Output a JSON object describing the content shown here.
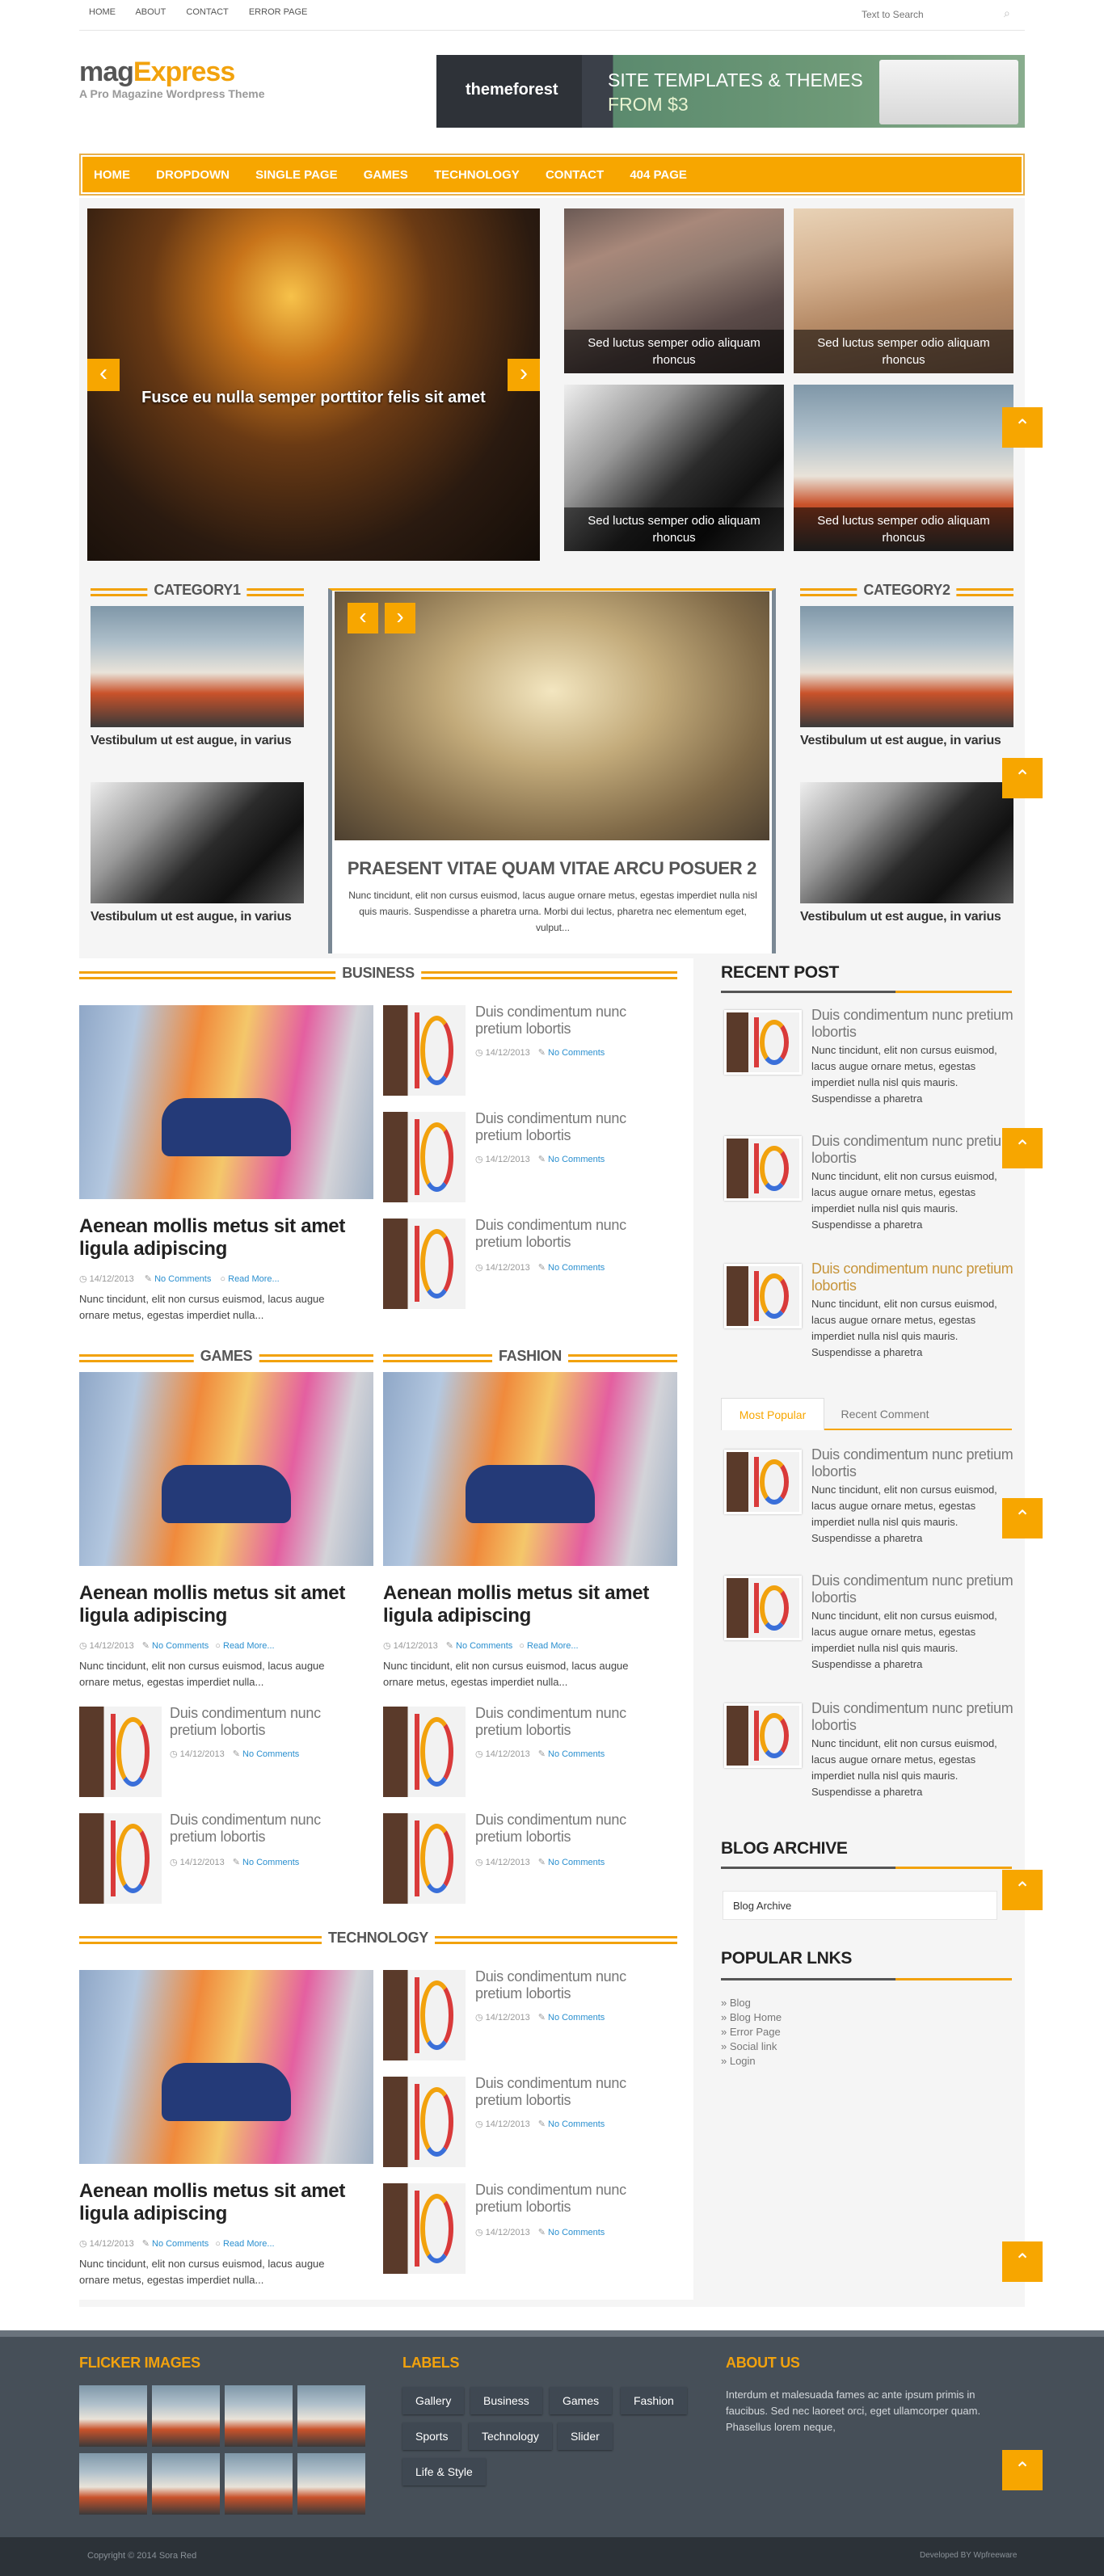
{
  "topnav": {
    "items": [
      "HOME",
      "ABOUT",
      "CONTACT",
      "ERROR PAGE"
    ],
    "search_placeholder": "Text to Search"
  },
  "brand": {
    "name_a": "mag",
    "name_b": "Express",
    "tagline": "A Pro Magazine Wordpress Theme"
  },
  "ad": {
    "logo": "themeforest",
    "headline": "SITE TEMPLATES & THEMES",
    "sub": "FROM $3"
  },
  "mainnav": {
    "items": [
      "HOME",
      "DROPDOWN",
      "SINGLE PAGE",
      "GAMES",
      "TECHNOLOGY",
      "CONTACT",
      "404 PAGE"
    ]
  },
  "slider": {
    "caption": "Fusce eu nulla semper porttitor felis sit amet",
    "prev": "‹",
    "next": "›"
  },
  "grid_captions": [
    "Sed luctus semper odio aliquam rhoncus",
    "Sed luctus semper odio aliquam rhoncus",
    "Sed luctus semper odio aliquam rhoncus",
    "Sed luctus semper odio aliquam rhoncus"
  ],
  "category1": {
    "title": "CATEGORY1",
    "posts": [
      "Vestibulum ut est augue, in varius",
      "Vestibulum ut est augue, in varius"
    ]
  },
  "category2": {
    "title": "CATEGORY2",
    "posts": [
      "Vestibulum ut est augue, in varius",
      "Vestibulum ut est augue, in varius"
    ]
  },
  "feature": {
    "title": "PRAESENT VITAE QUAM VITAE ARCU POSUER 2",
    "excerpt": "Nunc tincidunt, elit non cursus euismod, lacus augue ornare metus, egestas imperdiet nulla nisl quis mauris. Suspendisse a pharetra urna. Morbi dui lectus, pharetra nec elementum eget, vulput..."
  },
  "common": {
    "small_title": "Duis condimentum nunc pretium lobortis",
    "date": "14/12/2013",
    "comments": "No Comments",
    "read_more": "Read More...",
    "big_title": "Aenean mollis metus sit amet ligula adipiscing",
    "big_excerpt": "Nunc tincidunt, elit non cursus euismod, lacus augue ornare metus, egestas imperdiet nulla...",
    "side_excerpt": "Nunc tincidunt, elit non cursus euismod, lacus augue ornare metus, egestas imperdiet nulla nisl quis mauris. Suspendisse a pharetra"
  },
  "sections": {
    "business": "BUSINESS",
    "games": "GAMES",
    "fashion": "FASHION",
    "technology": "TECHNOLOGY"
  },
  "sidebar": {
    "recent_title": "RECENT POST",
    "tabs": [
      "Most Popular",
      "Recent Comment"
    ],
    "archive_title": "BLOG ARCHIVE",
    "archive_select": "Blog Archive",
    "links_title": "POPULAR LNKS",
    "links": [
      "Blog",
      "Blog Home",
      "Error Page",
      "Social link",
      "Login"
    ]
  },
  "footer": {
    "flickr_title": "FLICKER IMAGES",
    "labels_title": "LABELS",
    "labels": [
      "Gallery",
      "Business",
      "Games",
      "Fashion",
      "Sports",
      "Technology",
      "Slider",
      "Life & Style"
    ],
    "about_title": "ABOUT US",
    "about_text": "Interdum et malesuada fames ac ante ipsum primis in faucibus. Sed nec laoreet orci, eget ullamcorper quam. Phasellus lorem neque,",
    "copyright": "Copyright © 2014 Sora Red",
    "developed": "Developed BY Wpfreeware"
  },
  "colors": {
    "accent": "#f2a20d",
    "dark": "#3f4852"
  },
  "icons": {
    "up": "up-arrow-icon",
    "search": "search-icon",
    "clock": "clock-icon",
    "comment": "comment-icon"
  }
}
